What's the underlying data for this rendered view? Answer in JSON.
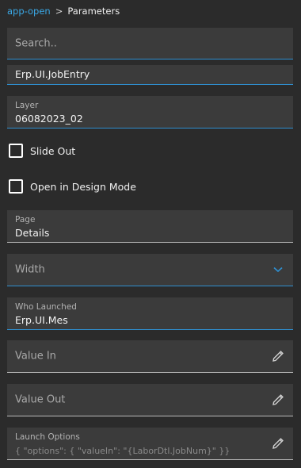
{
  "breadcrumb": {
    "parent": "app-open",
    "separator": ">",
    "current": "Parameters"
  },
  "search": {
    "placeholder": "Search.."
  },
  "fields": {
    "clipped_value": "Erp.UI.JobEntry",
    "layer": {
      "label": "Layer",
      "value": "06082023_02"
    },
    "slide_out": {
      "label": "Slide Out",
      "checked": false
    },
    "design_mode": {
      "label": "Open in Design Mode",
      "checked": false
    },
    "page": {
      "label": "Page",
      "value": "Details"
    },
    "width": {
      "placeholder": "Width"
    },
    "who_launched": {
      "label": "Who Launched",
      "value": "Erp.UI.Mes"
    },
    "value_in": {
      "placeholder": "Value In"
    },
    "value_out": {
      "placeholder": "Value Out"
    },
    "launch_options": {
      "label": "Launch Options",
      "preview": "{  \"options\": {    \"valueIn\": \"{LaborDtl.JobNum}\"  }}"
    }
  },
  "colors": {
    "accent": "#2f8fd0",
    "link": "#3aa8e6",
    "background": "#2b2b2b",
    "field": "#3b3b3b"
  },
  "icons": {
    "dropdown": "chevron-down-icon",
    "edit": "pencil-icon"
  }
}
